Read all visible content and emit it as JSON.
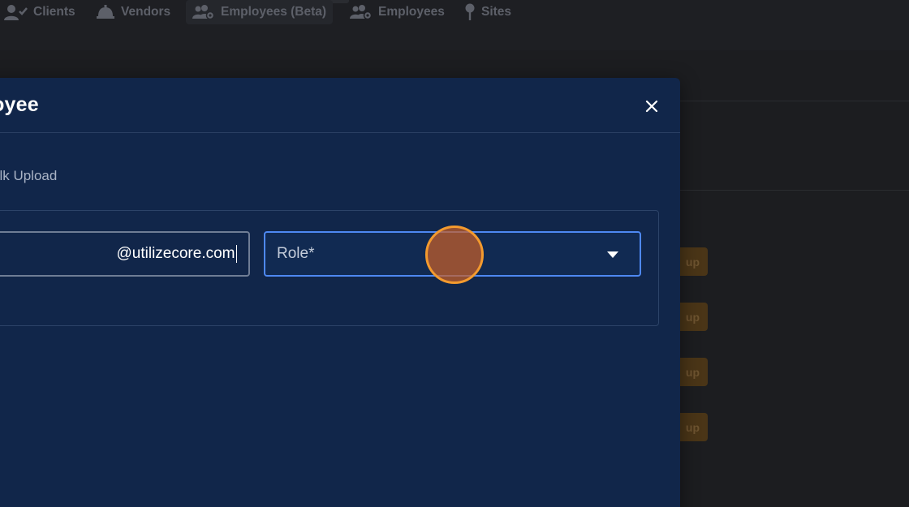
{
  "nav": {
    "items": [
      {
        "label": "Clients",
        "icon": "user-check-icon"
      },
      {
        "label": "Vendors",
        "icon": "bell-icon"
      },
      {
        "label": "Employees (Beta)",
        "icon": "users-gear-icon"
      },
      {
        "label": "Employees",
        "icon": "users-gear-icon"
      },
      {
        "label": "Sites",
        "icon": "map-pin-icon"
      }
    ]
  },
  "background": {
    "badge_label": "up"
  },
  "modal": {
    "title": "nployee",
    "close_icon": "close-icon",
    "bulk_upload_label": "ulk Upload",
    "email_value": "@utilizecore.com",
    "role_placeholder": "Role*",
    "colors": {
      "modal_bg": "#11264a",
      "focus_border": "#4e88f2",
      "click_marker": "#f39a2e"
    }
  }
}
